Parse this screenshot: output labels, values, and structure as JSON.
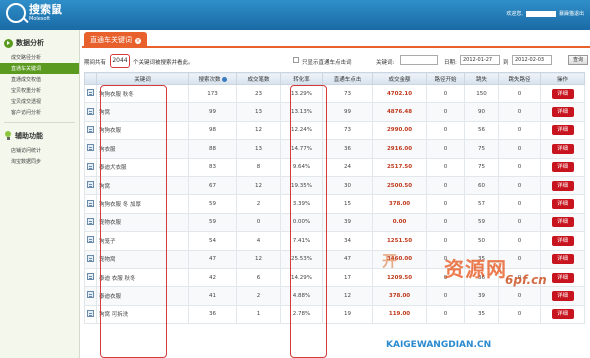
{
  "header": {
    "logo_cn": "搜索鼠",
    "logo_en": "Molesoft",
    "welcome": "欢迎您,",
    "logout": "暴躁猫退出"
  },
  "sidebar": {
    "section1_title": "数据分析",
    "items": [
      "成交路径分析",
      "直通车关键词",
      "直通成交权值",
      "宝贝权重分析",
      "宝贝成交透视",
      "客户访问分析"
    ],
    "active_index": 1,
    "section2_title": "辅助功能",
    "items2": [
      "店铺访问统计",
      "淘宝数据同步"
    ]
  },
  "tab": {
    "label": "直通车关键词",
    "close": "×"
  },
  "filter": {
    "prefix": "期间共有",
    "count": "2044",
    "suffix": "个关键词被搜索并看此。",
    "checkbox_label": "只显示直通车点击词",
    "keyword_label": "关键词:",
    "date_label": "日期:",
    "date_from": "2012-01-27",
    "to_label": "到",
    "date_to": "2012-02-03",
    "query_button": "查询"
  },
  "table": {
    "headers": [
      "",
      "关键词",
      "搜索次数",
      "成交笔数",
      "转化率",
      "直通车点击",
      "成交金额",
      "路径开始",
      "跳失",
      "跳失路径",
      "操作"
    ],
    "detail_label": "详细",
    "rows": [
      [
        "狗狗衣服 秋冬",
        "173",
        "23",
        "13.29%",
        "73",
        "4702.10",
        "0",
        "150",
        "0"
      ],
      [
        "狗窝",
        "99",
        "13",
        "13.13%",
        "99",
        "4876.48",
        "0",
        "90",
        "0"
      ],
      [
        "狗狗衣服",
        "98",
        "12",
        "12.24%",
        "73",
        "2990.00",
        "0",
        "56",
        "0"
      ],
      [
        "狗衣服",
        "88",
        "13",
        "14.77%",
        "36",
        "2916.00",
        "0",
        "75",
        "0"
      ],
      [
        "泰迪犬衣服",
        "83",
        "8",
        "9.64%",
        "24",
        "2517.50",
        "0",
        "75",
        "0"
      ],
      [
        "狗窝",
        "67",
        "12",
        "19.35%",
        "30",
        "2500.50",
        "0",
        "60",
        "0"
      ],
      [
        "狗狗衣服 冬 加厚",
        "59",
        "2",
        "3.39%",
        "15",
        "378.00",
        "0",
        "57",
        "0"
      ],
      [
        "宠物衣服",
        "59",
        "0",
        "0.00%",
        "39",
        "0.00",
        "0",
        "59",
        "0"
      ],
      [
        "狗笼子",
        "54",
        "4",
        "7.41%",
        "34",
        "1251.50",
        "0",
        "50",
        "0"
      ],
      [
        "宠物窝",
        "47",
        "12",
        "25.53%",
        "47",
        "3460.00",
        "0",
        "35",
        "0"
      ],
      [
        "泰迪 衣服 秋冬",
        "42",
        "6",
        "14.29%",
        "17",
        "1209.50",
        "0",
        "36",
        "0"
      ],
      [
        "泰迪衣服",
        "41",
        "2",
        "4.88%",
        "12",
        "378.00",
        "0",
        "39",
        "0"
      ],
      [
        "狗窝 可拆洗",
        "36",
        "1",
        "2.78%",
        "19",
        "119.00",
        "0",
        "35",
        "0"
      ]
    ]
  },
  "watermark": {
    "cn1": "开",
    "cn2": "资源网",
    "domain": "6pf.cn",
    "url": "KAIGEWANGDIAN.CN"
  },
  "colors": {
    "header_blue": "#1a6aa5",
    "accent_orange": "#e8602c",
    "sidebar_green": "#5a9a1e",
    "detail_red": "#c8141e",
    "outline_red": "#d63b3b"
  }
}
